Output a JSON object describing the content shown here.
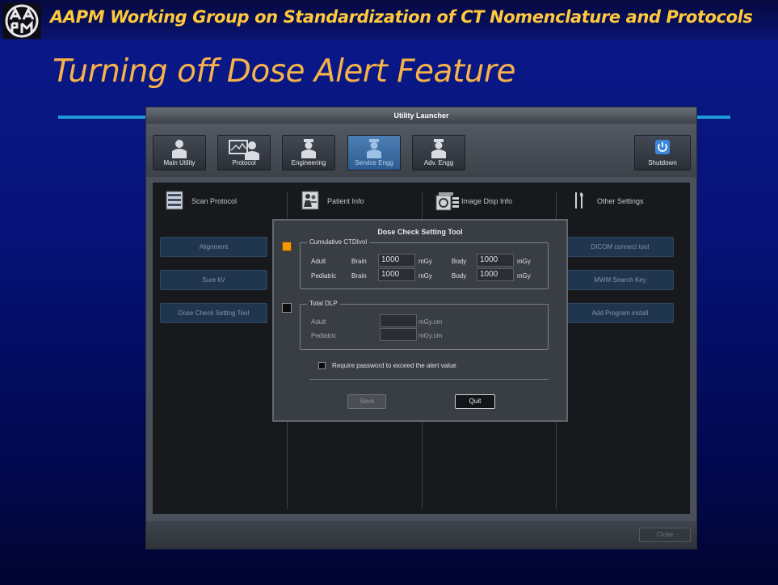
{
  "header": {
    "text": "AAPM Working Group on Standardization of CT Nomenclature and Protocols",
    "logo_icon": "aapm-logo-icon"
  },
  "slide": {
    "title": "Turning off Dose Alert Feature"
  },
  "utility_launcher": {
    "title": "Utility Launcher",
    "toolbar": [
      {
        "label": "Main Utility",
        "icon": "person-icon",
        "active": false
      },
      {
        "label": "Protocol",
        "icon": "protocol-icon",
        "active": false
      },
      {
        "label": "Engineering",
        "icon": "engineer-icon",
        "active": false
      },
      {
        "label": "Service Engg",
        "icon": "service-engineer-icon",
        "active": true
      },
      {
        "label": "Adv. Engg",
        "icon": "advanced-engineer-icon",
        "active": false
      }
    ],
    "shutdown_label": "Shutdown",
    "categories": [
      {
        "label": "Scan Protocol",
        "icon": "scan-protocol-icon"
      },
      {
        "label": "Patient Info",
        "icon": "patient-info-icon"
      },
      {
        "label": "Image Disp Info",
        "icon": "image-display-icon"
      },
      {
        "label": "Other Settings",
        "icon": "tools-icon"
      }
    ],
    "scan_protocol_buttons": [
      "Alignment",
      "Sure kV",
      "Dose Check Setting Tool"
    ],
    "other_settings_buttons": [
      "DICOM connect tool",
      "MWM Search Key",
      "Add Program install"
    ],
    "close_label": "Close"
  },
  "dialog": {
    "title": "Dose Check Setting Tool",
    "ctdi_section": {
      "legend": "Cumulative CTDIvol",
      "enabled": true,
      "rows": [
        {
          "group": "Adult",
          "brain_label": "Brain",
          "brain_value": "1000",
          "brain_unit": "mGy",
          "body_label": "Body",
          "body_value": "1000",
          "body_unit": "mGy"
        },
        {
          "group": "Pediatric",
          "brain_label": "Brain",
          "brain_value": "1000",
          "brain_unit": "mGy",
          "body_label": "Body",
          "body_value": "1000",
          "body_unit": "mGy"
        }
      ]
    },
    "dlp_section": {
      "legend": "Total DLP",
      "enabled": false,
      "rows": [
        {
          "group": "Adult",
          "value": "",
          "unit": "mGy.cm"
        },
        {
          "group": "Pediatric",
          "value": "",
          "unit": "mGy.cm"
        }
      ]
    },
    "password_checkbox_label": "Require password to exceed the alert value",
    "password_checked": false,
    "save_label": "Save",
    "quit_label": "Quit",
    "colors": {
      "marker_on": "#f59a06",
      "active_tab": "#3d6fa6",
      "header_text": "#ffc93c",
      "title_text": "#f8b24a"
    }
  }
}
